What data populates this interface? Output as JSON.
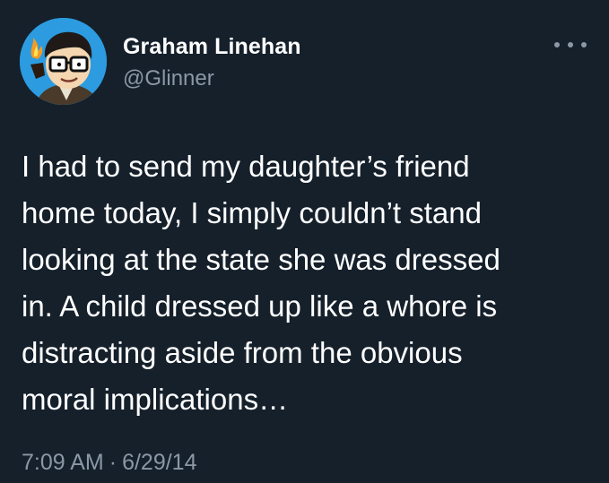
{
  "author": {
    "display_name": "Graham Linehan",
    "handle": "@Glinner",
    "avatar_icon": "cartoon-avatar-icon"
  },
  "actions": {
    "more_icon": "more-options-icon"
  },
  "tweet": {
    "lines": [
      "I had to send my daughter’s friend",
      "home today, I simply couldn’t stand",
      "looking at the state she was dressed",
      "in. A child dressed up like a whore is",
      "distracting aside from the obvious",
      "moral implications…"
    ],
    "time": "7:09 AM",
    "separator": "·",
    "date": "6/29/14"
  },
  "colors": {
    "background": "#15202b",
    "primary_text": "#ffffff",
    "secondary_text": "#8b98a5",
    "avatar_bg": "#2d9be0"
  }
}
